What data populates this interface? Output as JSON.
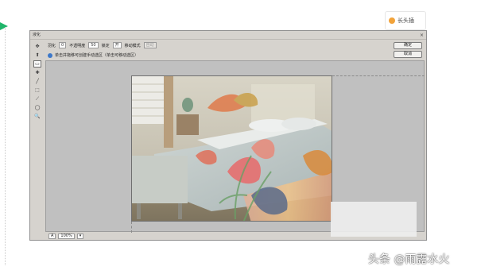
{
  "top_right_tab": {
    "label": "长头插"
  },
  "dialog": {
    "title": "液化",
    "close_glyph": "×",
    "options": {
      "brush_size_label": "羽化",
      "brush_size_value": "0",
      "density_label": "不透明度",
      "density_value": "50",
      "mode_label": "锁定",
      "mode_value": "开",
      "blend_label": "移动模式",
      "blend_value": "自动"
    },
    "hint": "单击并拖移可创建手动选区（单击可移动选区）",
    "buttons": {
      "ok": "确定",
      "cancel": "取消"
    },
    "tools": [
      "✥",
      "⬆",
      "▭",
      "✚",
      "╱",
      "⬚",
      "⟋",
      "◯",
      "🔍"
    ],
    "status": {
      "zoom": "100%",
      "size_left": "A",
      "dropdown": "▾"
    }
  },
  "watermark": "头条 @雨露水火"
}
